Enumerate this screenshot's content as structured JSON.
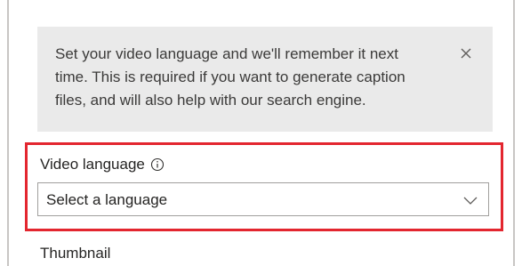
{
  "notice": {
    "line1": "Set your video language and we'll remember it next",
    "line2": "time. This is required if you want to generate caption",
    "line3": "files, and will also help with our search engine.",
    "close_icon": "close-icon"
  },
  "language_field": {
    "label": "Video language",
    "info_icon": "info-icon",
    "selected_value": "Select a language",
    "dropdown_icon": "chevron-down-icon"
  },
  "thumbnail": {
    "label": "Thumbnail"
  },
  "colors": {
    "highlight": "#e3262f",
    "notice_bg": "#eaeaea"
  }
}
